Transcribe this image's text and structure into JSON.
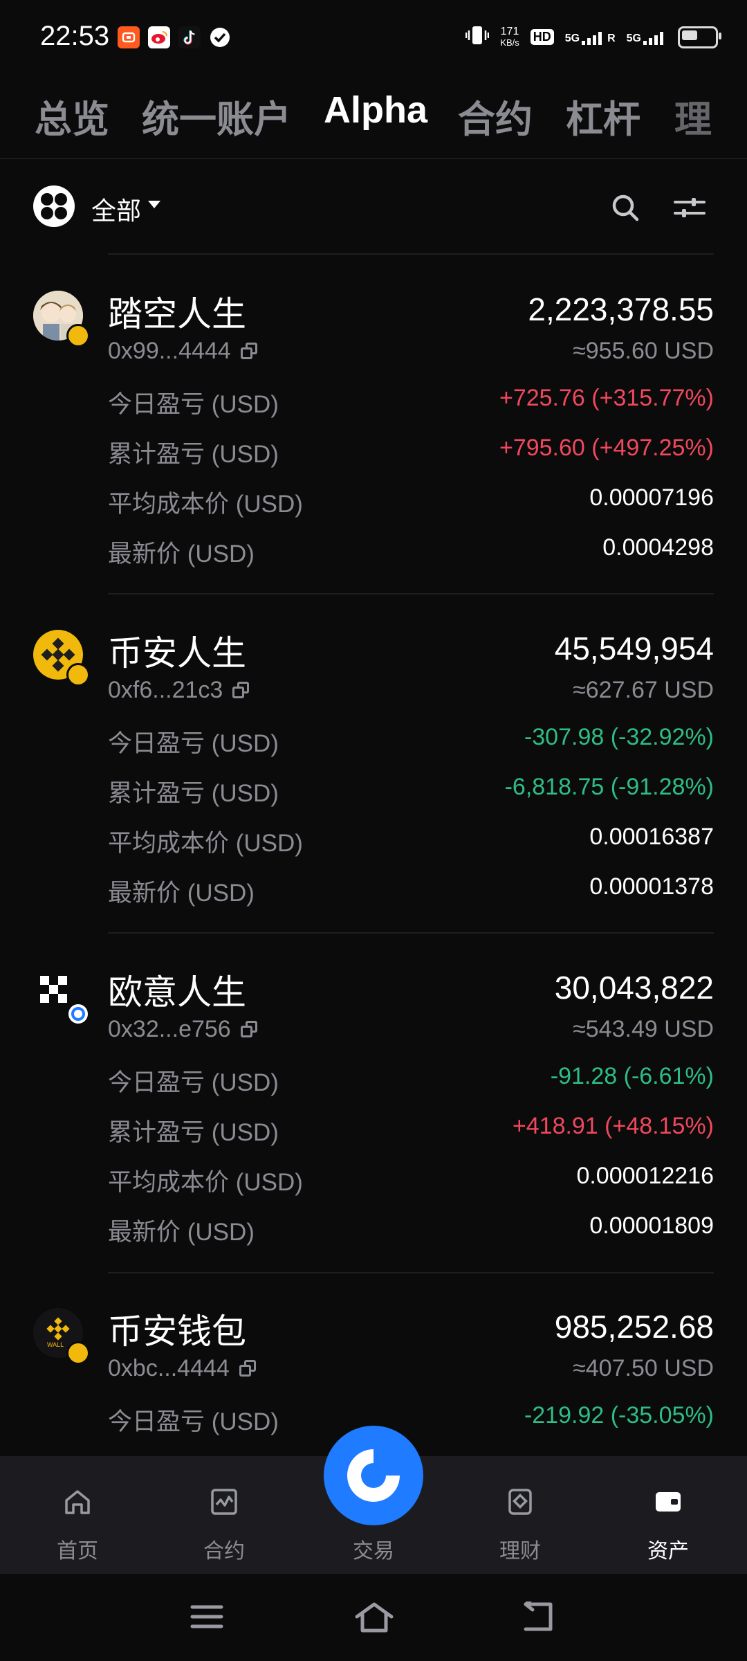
{
  "status": {
    "time": "22:53",
    "net_speed_top": "171",
    "net_speed_unit": "KB/s",
    "hd": "HD",
    "sim1": "5G",
    "sim2": "5G",
    "roaming": "R",
    "battery_level": 0.55
  },
  "tabs": [
    {
      "label": "总览",
      "active": false
    },
    {
      "label": "统一账户",
      "active": false
    },
    {
      "label": "Alpha",
      "active": true
    },
    {
      "label": "合约",
      "active": false
    },
    {
      "label": "杠杆",
      "active": false
    },
    {
      "label": "理",
      "active": false
    }
  ],
  "filter": {
    "label": "全部"
  },
  "assets": [
    {
      "name": "踏空人生",
      "address": "0x99...4444",
      "amount": "2,223,378.55",
      "usd_value": "≈955.60 USD",
      "rows": [
        {
          "label": "今日盈亏 (USD)",
          "value": "+725.76 (+315.77%)",
          "tone": "pos"
        },
        {
          "label": "累计盈亏 (USD)",
          "value": "+795.60 (+497.25%)",
          "tone": "pos"
        },
        {
          "label": "平均成本价 (USD)",
          "value": "0.00007196",
          "tone": "plain"
        },
        {
          "label": "最新价 (USD)",
          "value": "0.0004298",
          "tone": "plain"
        }
      ]
    },
    {
      "name": "币安人生",
      "address": "0xf6...21c3",
      "amount": "45,549,954",
      "usd_value": "≈627.67 USD",
      "rows": [
        {
          "label": "今日盈亏 (USD)",
          "value": "-307.98 (-32.92%)",
          "tone": "neg"
        },
        {
          "label": "累计盈亏 (USD)",
          "value": "-6,818.75 (-91.28%)",
          "tone": "neg"
        },
        {
          "label": "平均成本价 (USD)",
          "value": "0.00016387",
          "tone": "plain"
        },
        {
          "label": "最新价 (USD)",
          "value": "0.00001378",
          "tone": "plain"
        }
      ]
    },
    {
      "name": "欧意人生",
      "address": "0x32...e756",
      "amount": "30,043,822",
      "usd_value": "≈543.49 USD",
      "rows": [
        {
          "label": "今日盈亏 (USD)",
          "value": "-91.28 (-6.61%)",
          "tone": "neg"
        },
        {
          "label": "累计盈亏 (USD)",
          "value": "+418.91 (+48.15%)",
          "tone": "pos"
        },
        {
          "label": "平均成本价 (USD)",
          "value": "0.000012216",
          "tone": "plain"
        },
        {
          "label": "最新价 (USD)",
          "value": "0.00001809",
          "tone": "plain"
        }
      ]
    },
    {
      "name": "币安钱包",
      "address": "0xbc...4444",
      "amount": "985,252.68",
      "usd_value": "≈407.50 USD",
      "wallet_logo_text": "WALL",
      "rows": [
        {
          "label": "今日盈亏 (USD)",
          "value": "-219.92 (-35.05%)",
          "tone": "neg"
        }
      ]
    }
  ],
  "bottom_nav": [
    {
      "label": "首页",
      "icon": "home-icon",
      "active": false
    },
    {
      "label": "合约",
      "icon": "futures-chart-icon",
      "active": false
    },
    {
      "label": "交易",
      "icon": "trade-icon",
      "active": false
    },
    {
      "label": "理财",
      "icon": "earn-icon",
      "active": false
    },
    {
      "label": "资产",
      "icon": "wallet-icon",
      "active": true
    }
  ],
  "colors": {
    "background": "#0b0b0c",
    "positive": "#f0485c",
    "negative": "#2ebd85",
    "muted": "#8b8b92",
    "accent": "#1f7bff",
    "binance_yellow": "#f0b90b"
  }
}
